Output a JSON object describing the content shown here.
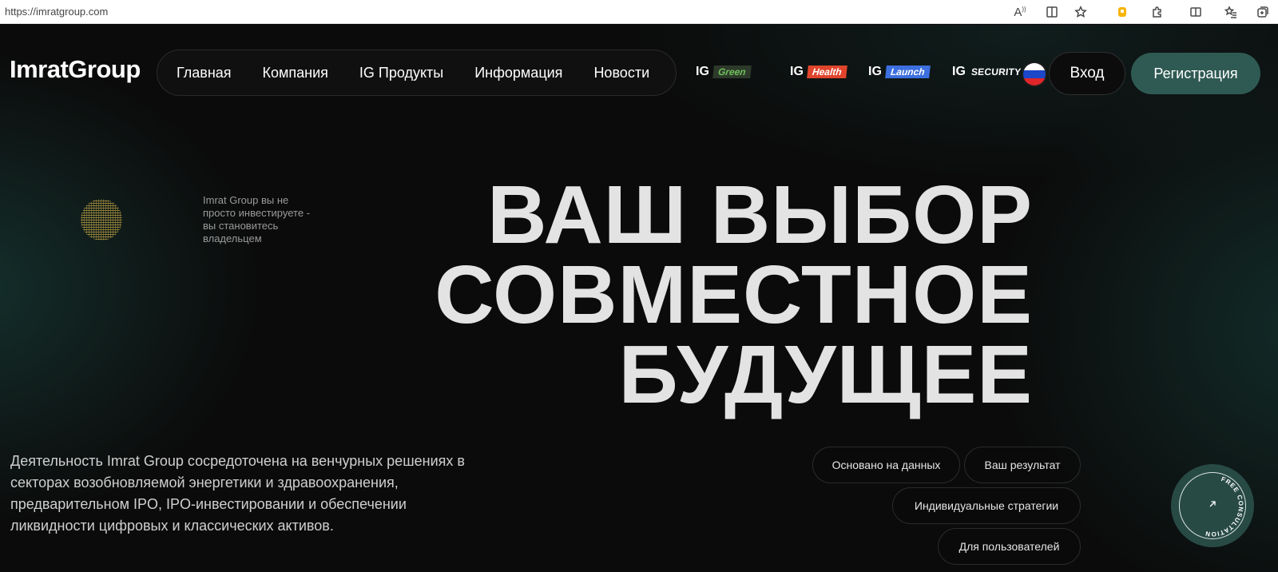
{
  "browser": {
    "url": "https://imratgroup.com",
    "icons": [
      "read-aloud-icon",
      "immersive-reader-icon",
      "favorite-star-icon",
      "extension-yellow-icon",
      "extensions-puzzle-icon",
      "split-screen-icon",
      "favorites-icon",
      "collections-icon"
    ]
  },
  "header": {
    "logo": "ImratGroup",
    "nav": [
      "Главная",
      "Компания",
      "IG Продукты",
      "Информация",
      "Новости"
    ],
    "brands": [
      {
        "prefix": "IG",
        "tag": "Green",
        "color": "#6fbf5c"
      },
      {
        "prefix": "IG",
        "tag": "Health",
        "color": "#e0452c"
      },
      {
        "prefix": "IG",
        "tag": "Launch",
        "color": "#3c6fe0"
      },
      {
        "prefix": "IG",
        "tag": "SECURITY",
        "color": "#ffffff"
      }
    ],
    "language": "ru",
    "login": "Вход",
    "register": "Регистрация"
  },
  "hero": {
    "tagline": "Imrat Group вы не просто инвестируете - вы становитесь владельцем",
    "title_lines": [
      "ВАШ ВЫБОР",
      "СОВМЕСТНОЕ",
      "БУДУЩЕЕ"
    ],
    "description": "Деятельность Imrat Group сосредоточена на венчурных решениях в секторах возобновляемой энергетики и здравоохранения, предварительном IPO, IPO-инвестировании и обеспечении ликвидности цифровых и классических активов.",
    "pills": [
      "Основано на данных",
      "Ваш результат",
      "Индивидуальные стратегии",
      "Для пользователей"
    ],
    "consultation": "FREE CONSULTATION"
  },
  "colors": {
    "accent": "#2f5a53",
    "background": "#0b0b0b",
    "title_text": "#e3e3e3"
  }
}
